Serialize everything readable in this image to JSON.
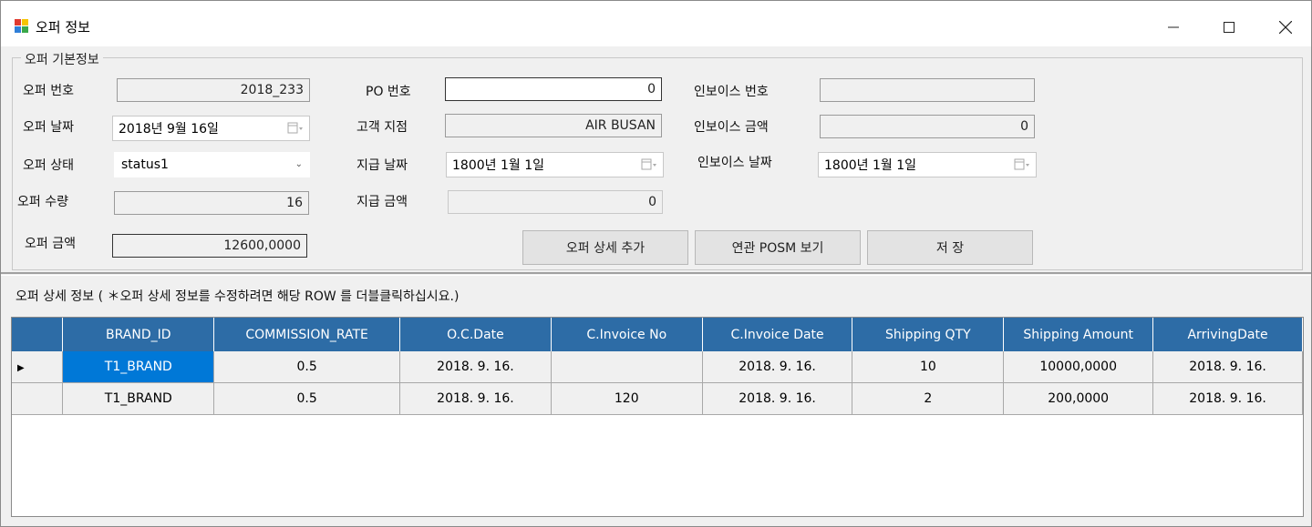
{
  "window": {
    "title": "오퍼 정보"
  },
  "groupbox": {
    "legend": "오퍼 기본정보"
  },
  "form": {
    "offer_no": {
      "label": "오퍼 번호",
      "value": "2018_233"
    },
    "offer_date": {
      "label": "오퍼 날짜",
      "value": "2018년   9월 16일"
    },
    "offer_status": {
      "label": "오퍼 상태",
      "value": "status1"
    },
    "offer_qty": {
      "label": "오퍼 수량",
      "value": "16"
    },
    "offer_amount": {
      "label": "오퍼 금액",
      "value": "12600,0000"
    },
    "po_no": {
      "label": "PO 번호",
      "value": "0"
    },
    "customer": {
      "label": "고객 지점",
      "value": "AIR BUSAN"
    },
    "pay_date": {
      "label": "지급 날짜",
      "value": "1800년   1월   1일"
    },
    "pay_amount": {
      "label": "지급 금액",
      "value": "0"
    },
    "invoice_no": {
      "label": "인보이스 번호",
      "value": ""
    },
    "invoice_amount": {
      "label": "인보이스 금액",
      "value": "0"
    },
    "invoice_date": {
      "label": "인보이스 날짜",
      "value": "1800년   1월   1일"
    }
  },
  "buttons": {
    "add_detail": "오퍼 상세 추가",
    "view_posm": "연관 POSM 보기",
    "save": "저 장"
  },
  "detail_label": "오퍼 상세 정보 ( ＊오퍼 상세 정보를 수정하려면 해당 ROW 를 더블클릭하십시요.)",
  "grid": {
    "columns": [
      "BRAND_ID",
      "COMMISSION_RATE",
      "O.C.Date",
      "C.Invoice No",
      "C.Invoice Date",
      "Shipping QTY",
      "Shipping Amount",
      "ArrivingDate"
    ],
    "rows": [
      [
        "T1_BRAND",
        "0.5",
        "2018. 9. 16.",
        "",
        "2018. 9. 16.",
        "10",
        "10000,0000",
        "2018. 9. 16."
      ],
      [
        "T1_BRAND",
        "0.5",
        "2018. 9. 16.",
        "120",
        "2018. 9. 16.",
        "2",
        "200,0000",
        "2018. 9. 16."
      ]
    ]
  }
}
